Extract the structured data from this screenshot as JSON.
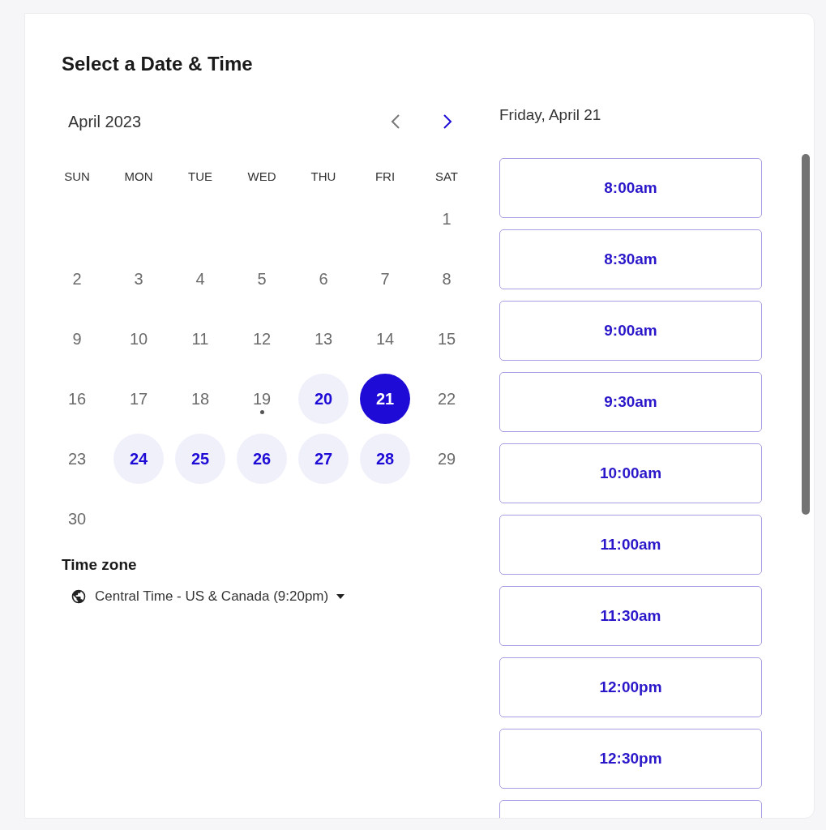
{
  "title": "Select a Date & Time",
  "calendar": {
    "month": "April 2023",
    "prev_enabled": false,
    "next_enabled": true,
    "weekdays": [
      "SUN",
      "MON",
      "TUE",
      "WED",
      "THU",
      "FRI",
      "SAT"
    ],
    "days": [
      {
        "kind": "blank"
      },
      {
        "kind": "blank"
      },
      {
        "kind": "blank"
      },
      {
        "kind": "blank"
      },
      {
        "kind": "blank"
      },
      {
        "kind": "blank"
      },
      {
        "kind": "day",
        "label": "1",
        "available": false,
        "selected": false,
        "today": false
      },
      {
        "kind": "day",
        "label": "2",
        "available": false,
        "selected": false,
        "today": false
      },
      {
        "kind": "day",
        "label": "3",
        "available": false,
        "selected": false,
        "today": false
      },
      {
        "kind": "day",
        "label": "4",
        "available": false,
        "selected": false,
        "today": false
      },
      {
        "kind": "day",
        "label": "5",
        "available": false,
        "selected": false,
        "today": false
      },
      {
        "kind": "day",
        "label": "6",
        "available": false,
        "selected": false,
        "today": false
      },
      {
        "kind": "day",
        "label": "7",
        "available": false,
        "selected": false,
        "today": false
      },
      {
        "kind": "day",
        "label": "8",
        "available": false,
        "selected": false,
        "today": false
      },
      {
        "kind": "day",
        "label": "9",
        "available": false,
        "selected": false,
        "today": false
      },
      {
        "kind": "day",
        "label": "10",
        "available": false,
        "selected": false,
        "today": false
      },
      {
        "kind": "day",
        "label": "11",
        "available": false,
        "selected": false,
        "today": false
      },
      {
        "kind": "day",
        "label": "12",
        "available": false,
        "selected": false,
        "today": false
      },
      {
        "kind": "day",
        "label": "13",
        "available": false,
        "selected": false,
        "today": false
      },
      {
        "kind": "day",
        "label": "14",
        "available": false,
        "selected": false,
        "today": false
      },
      {
        "kind": "day",
        "label": "15",
        "available": false,
        "selected": false,
        "today": false
      },
      {
        "kind": "day",
        "label": "16",
        "available": false,
        "selected": false,
        "today": false
      },
      {
        "kind": "day",
        "label": "17",
        "available": false,
        "selected": false,
        "today": false
      },
      {
        "kind": "day",
        "label": "18",
        "available": false,
        "selected": false,
        "today": false
      },
      {
        "kind": "day",
        "label": "19",
        "available": false,
        "selected": false,
        "today": true
      },
      {
        "kind": "day",
        "label": "20",
        "available": true,
        "selected": false,
        "today": false
      },
      {
        "kind": "day",
        "label": "21",
        "available": true,
        "selected": true,
        "today": false
      },
      {
        "kind": "day",
        "label": "22",
        "available": false,
        "selected": false,
        "today": false
      },
      {
        "kind": "day",
        "label": "23",
        "available": false,
        "selected": false,
        "today": false
      },
      {
        "kind": "day",
        "label": "24",
        "available": true,
        "selected": false,
        "today": false
      },
      {
        "kind": "day",
        "label": "25",
        "available": true,
        "selected": false,
        "today": false
      },
      {
        "kind": "day",
        "label": "26",
        "available": true,
        "selected": false,
        "today": false
      },
      {
        "kind": "day",
        "label": "27",
        "available": true,
        "selected": false,
        "today": false
      },
      {
        "kind": "day",
        "label": "28",
        "available": true,
        "selected": false,
        "today": false
      },
      {
        "kind": "day",
        "label": "29",
        "available": false,
        "selected": false,
        "today": false
      },
      {
        "kind": "day",
        "label": "30",
        "available": false,
        "selected": false,
        "today": false
      }
    ]
  },
  "time_zone": {
    "label": "Time zone",
    "value": "Central Time - US & Canada (9:20pm)"
  },
  "selected_date": "Friday, April 21",
  "slots": [
    {
      "kind": "slot",
      "time": "8:00am"
    },
    {
      "kind": "slot",
      "time": "8:30am"
    },
    {
      "kind": "slot",
      "time": "9:00am"
    },
    {
      "kind": "slot",
      "time": "9:30am"
    },
    {
      "kind": "slot",
      "time": "10:00am"
    },
    {
      "kind": "slot",
      "time": "11:00am"
    },
    {
      "kind": "slot",
      "time": "11:30am"
    },
    {
      "kind": "slot",
      "time": "12:00pm"
    },
    {
      "kind": "slot",
      "time": "12:30pm"
    },
    {
      "kind": "partial"
    }
  ]
}
